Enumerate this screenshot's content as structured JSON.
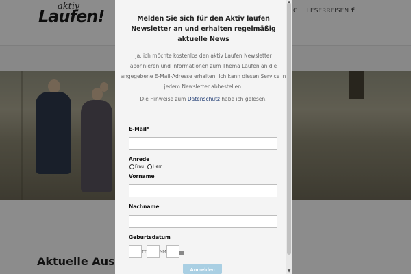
{
  "site": {
    "logo_small": "aktiv",
    "logo_big": "Laufen!",
    "nav_partial": "C",
    "nav_item": "LESERREISEN",
    "facebook_icon": "f"
  },
  "main": {
    "section_title": "Aktuelle Ausg"
  },
  "modal": {
    "title": "Melden Sie sich für den Aktiv laufen Newsletter an und erhalten regelmäßig aktuelle News",
    "consent_text": "Ja, ich möchte kostenlos den aktiv Laufen Newsletter abonnieren und Informationen zum Thema Laufen an die angegebene E-Mail-Adresse erhalten. Ich kann diesen Service in jedem Newsletter abbestellen.",
    "privacy_prefix": "Die Hinweise zum ",
    "privacy_link": "Datenschutz",
    "privacy_suffix": " habe ich gelesen.",
    "email_label": "E-Mail*",
    "salutation_label": "Anrede",
    "salutation_options": [
      "Frau",
      "Herr"
    ],
    "firstname_label": "Vorname",
    "lastname_label": "Nachname",
    "birthdate_label": "Geburtsdatum",
    "birthdate_day_sep": "TT",
    "birthdate_month_sep": "MM",
    "submit_label": "Anmelden"
  },
  "colors": {
    "submit_bg": "#a9cfe3",
    "link": "#1f3b73",
    "modal_bg": "#f4f4f4"
  }
}
